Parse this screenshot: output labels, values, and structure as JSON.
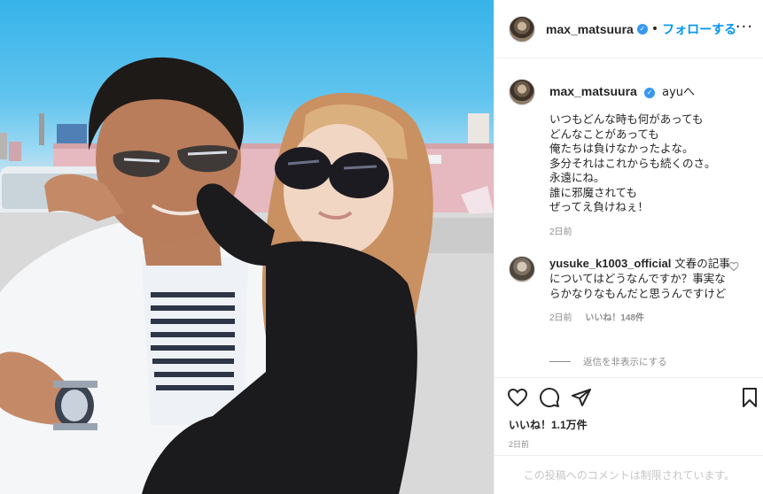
{
  "post": {
    "author": "max_matsuura",
    "follow_label": "フォローする",
    "dot": "•",
    "more_label": "···",
    "verified_glyph": "✓"
  },
  "caption": {
    "author": "max_matsuura",
    "mention": "ayuへ",
    "text": "いつもどんな時も何があっても\nどんなことがあっても\n俺たちは負けなかったよな。\n多分それはこれからも続くのさ。\n永遠にね。\n誰に邪魔されても\nぜってえ負けねぇ！",
    "time": "2日前"
  },
  "comment": {
    "author": "yusuke_k1003_official",
    "text": "文春の記事についてはどうなんですか？事実ならかなりなもんだと思うんですけど",
    "time": "2日前",
    "likes": "いいね！148件",
    "hide_replies": "返信を非表示にする"
  },
  "engagement": {
    "likes": "いいね！1.1万件",
    "time": "2日前"
  },
  "footer": {
    "notice": "この投稿へのコメントは制限されています。"
  },
  "icons": {
    "like": "heart-icon",
    "comment": "comment-bubble-icon",
    "share": "paper-plane-icon",
    "save": "bookmark-icon",
    "comment_like": "small-heart-icon",
    "more": "ellipsis-icon",
    "verified": "verified-badge-icon"
  },
  "colors": {
    "follow": "#0095f6",
    "verified": "#3897f0",
    "muted": "#8e8e8e",
    "divider": "#efefef"
  }
}
